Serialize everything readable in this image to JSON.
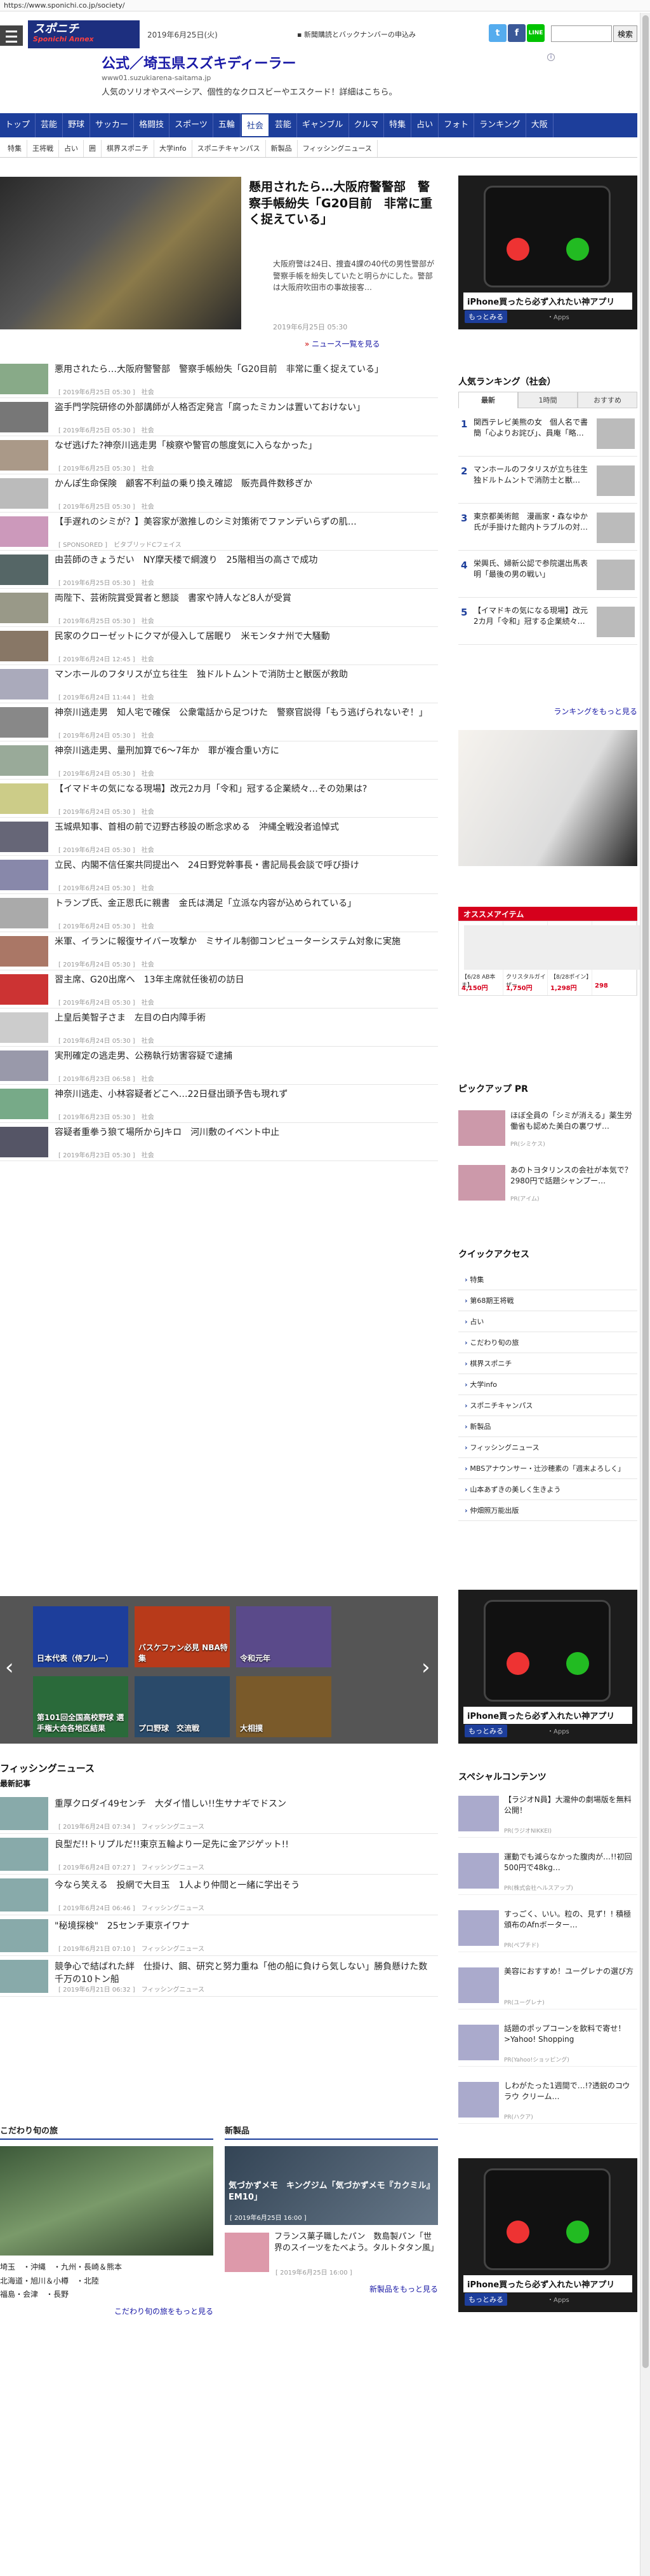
{
  "browser": {
    "url": "https://www.sponichi.co.jp/society/"
  },
  "header": {
    "logo_main": "スポニチ",
    "logo_sub": "Sponichi Annex",
    "date": "2019年6月25日(火)",
    "subscribe": "新聞購読とバックナンバーの申込み",
    "search_button": "検索",
    "search_placeholder": ""
  },
  "header_ad": {
    "title": "公式／埼玉県スズキディーラー",
    "url": "www01.suzukiarena-saitama.jp",
    "desc": "人気のソリオやスペーシア、個性的なクロスビーやエスクード！詳細はこちら。"
  },
  "gnav": [
    "トップ",
    "芸能",
    "野球",
    "サッカー",
    "格闘技",
    "スポーツ",
    "五輪",
    "社会",
    "芸能",
    "ギャンブル",
    "クルマ",
    "特集",
    "占い",
    "フォト",
    "ランキング",
    "大阪"
  ],
  "gnav_active": 7,
  "subnav": [
    "特集",
    "王将戦",
    "占い",
    "囲",
    "棋界スポニチ",
    "大学info",
    "スポニチキャンパス",
    "新製品",
    "フィッシングニュース"
  ],
  "hero": {
    "title": "懸用されたら…大阪府警警部　警察手帳紛失「G20目前　非常に重く捉えている」",
    "body": "大阪府警は24日、捜査4課の40代の男性警部が警察手帳を紛失していたと明らかにした。警部は大阪府吹田市の事故接客…",
    "date": "2019年6月25日 05:30",
    "more": "ニュース一覧を見る"
  },
  "news": [
    {
      "title": "悪用されたら…大阪府警警部　警察手帳紛失「G20目前　非常に重く捉えている」",
      "meta": "[ 2019年6月25日 05:30 ]　社会"
    },
    {
      "title": "盗手門学院研修の外部講師が人格否定発言「腐ったミカンは置いておけない」",
      "meta": "[ 2019年6月25日 05:30 ]　社会"
    },
    {
      "title": "なぜ逃げた?神奈川逃走男「検察や警官の態度気に入らなかった」",
      "meta": "[ 2019年6月25日 05:30 ]　社会"
    },
    {
      "title": "かんぽ生命保険　顧客不利益の乗り換え確認　販売員件数移ぎか",
      "meta": "[ 2019年6月25日 05:30 ]　社会"
    },
    {
      "title": "【手遅れのシミが？】美容家が激推しのシミ対策術でファンデいらずの肌…",
      "meta": "[ SPONSORED ]　ビタブリッドCフェイス"
    },
    {
      "title": "由芸師のきょうだい　NY摩天楼で綱渡り　25階相当の高さで成功",
      "meta": "[ 2019年6月25日 05:30 ]　社会"
    },
    {
      "title": "両陛下、芸術院賞受賞者と懇談　書家や詩人など8人が受賞",
      "meta": "[ 2019年6月25日 05:30 ]　社会"
    },
    {
      "title": "民家のクローゼットにクマが侵入して居眠り　米モンタナ州で大騒動",
      "meta": "[ 2019年6月24日 12:45 ]　社会"
    },
    {
      "title": "マンホールのフタリスが立ち往生　独ドルトムントで消防士と獣医が救助",
      "meta": "[ 2019年6月24日 11:44 ]　社会"
    },
    {
      "title": "神奈川逃走男　知人宅で確保　公衆電話から足つけた　警察官説得「もう逃げられないぞ！」",
      "meta": "[ 2019年6月24日 05:30 ]　社会"
    },
    {
      "title": "神奈川逃走男、量刑加算で6～7年か　罪が複合重い方に",
      "meta": "[ 2019年6月24日 05:30 ]　社会"
    },
    {
      "title": "【イマドキの気になる現場】改元2カ月「令和」冠する企業続々…その効果は?",
      "meta": "[ 2019年6月24日 05:30 ]　社会"
    },
    {
      "title": "玉城県知事、首相の前で辺野古移設の断念求める　沖縄全戦没者追悼式",
      "meta": "[ 2019年6月24日 05:30 ]　社会"
    },
    {
      "title": "立民、内閣不信任案共同提出へ　24日野党幹事長・書記局長会談で呼び掛け",
      "meta": "[ 2019年6月24日 05:30 ]　社会"
    },
    {
      "title": "トランプ氏、金正恩氏に親書　金氏は満足「立派な内容が込められている」",
      "meta": "[ 2019年6月24日 05:30 ]　社会"
    },
    {
      "title": "米軍、イランに報復サイバー攻撃か　ミサイル制御コンピューターシステム対象に実施",
      "meta": "[ 2019年6月24日 05:30 ]　社会"
    },
    {
      "title": "習主席、G20出席へ　13年主席就任後初の訪日",
      "meta": "[ 2019年6月24日 05:30 ]　社会"
    },
    {
      "title": "上皇后美智子さま　左目の白内障手術",
      "meta": "[ 2019年6月24日 05:30 ]　社会"
    },
    {
      "title": "実刑確定の逃走男、公務執行妨害容疑で逮捕",
      "meta": "[ 2019年6月23日 06:58 ]　社会"
    },
    {
      "title": "神奈川逃走、小林容疑者どこへ…22日昼出頭予告も現れず",
      "meta": "[ 2019年6月23日 05:30 ]　社会"
    },
    {
      "title": "容疑者重拳う狼て場所からJキロ　河川敷のイベント中止",
      "meta": "[ 2019年6月23日 05:30 ]　社会"
    }
  ],
  "carousel": {
    "tiles": [
      "日本代表（侍ブルー）",
      "バスケファン必見 NBA特集",
      "令和元年",
      "第101回全国高校野球 選手権大会各地区結果",
      "プロ野球　交流戦",
      "大相撲"
    ]
  },
  "fishing": {
    "heading": "フィッシングニュース",
    "subheading": "最新記事",
    "items": [
      {
        "title": "重厚クロダイ49センチ　大ダイ惜しい!!生サナギでドスン",
        "meta": "[ 2019年6月24日 07:34 ]　フィッシングニュース"
      },
      {
        "title": "良型だ!!トリプルだ!!東京五輪より一足先に金アジゲット!!",
        "meta": "[ 2019年6月24日 07:27 ]　フィッシングニュース"
      },
      {
        "title": "今なら笑える　投網で大目玉　1人より仲間と一緒に学出そう",
        "meta": "[ 2019年6月24日 06:46 ]　フィッシングニュース"
      },
      {
        "title": "\"秘境探検\"　25センチ東京イワナ",
        "meta": "[ 2019年6月21日 07:10 ]　フィッシングニュース"
      },
      {
        "title": "競争心で結ばれた絆　仕掛け、餌、研究と努力重ね「他の船に負けら気しない」勝負懸けた数千万の10トン船",
        "meta": "[ 2019年6月21日 06:32 ]　フィッシングニュース"
      }
    ]
  },
  "kodawari": {
    "heading": "こだわり旬の旅",
    "links": [
      "埼玉　・沖縄　・九州・長崎＆熊本",
      "北海道・旭川＆小樽　・北陸",
      "福島・会津　・長野"
    ],
    "more": "こだわり旬の旅をもっと見る"
  },
  "shinseihin": {
    "heading": "新製品",
    "item1_title": "気づかずメモ　キングジム「気づかずメモ『カクミル』EM10」",
    "item1_date": "[ 2019年6月25日 16:00 ]",
    "item2_title": "フランス菓子職したパン　数島製パン「世界のスイーツをたべよう。タルトタタン風」",
    "item2_date": "[ 2019年6月25日 16:00 ]",
    "more": "新製品をもっと見る"
  },
  "side_ads": {
    "caption": "iPhone買ったら必ず入れたい神アプリ",
    "more": "もっとみる",
    "apps": "・Apps"
  },
  "ranking": {
    "heading": "人気ランキング（社会）",
    "tabs": [
      "最新",
      "1時間",
      "おすすめ"
    ],
    "items": [
      {
        "n": "1",
        "title": "関西テレビ美熊の女　個人名で書簡「心よりお詫び」、員庵「略…"
      },
      {
        "n": "2",
        "title": "マンホールのフタリスが立ち往生　独ドルトムントで消防士と獣…"
      },
      {
        "n": "3",
        "title": "東京都美術館　漫画家・森なゆか氏が手掛けた館内トラブルの対…"
      },
      {
        "n": "4",
        "title": "栄興氏、婦新公認で参院選出馬表明「最後の男の戦い」"
      },
      {
        "n": "5",
        "title": "【イマドキの気になる現場】改元2カ月「令和」冠する企業続々…"
      }
    ],
    "more": "ランキングをもっと見る"
  },
  "osusume": {
    "heading": "オススメアイテム",
    "items": [
      {
        "name": "【6/28 AB本ま】",
        "price": "4,150円"
      },
      {
        "name": "クリスタルガイザー",
        "price": "1,750円"
      },
      {
        "name": "【8/28ポイン】",
        "price": "1,298円"
      },
      {
        "name": "",
        "price": "298"
      }
    ]
  },
  "pickup_pr": {
    "heading": "ピックアップ PR",
    "items": [
      {
        "title": "ほぼ全員の「シミが消える」薬生労働省も認めた美白の裏ワザ…",
        "src": "PR(シミケス)"
      },
      {
        "title": "あのトヨタリンスの会社が本気で？2980円で話題シャンプー…",
        "src": "PR(アイム)"
      }
    ]
  },
  "quick_access": {
    "heading": "クイックアクセス",
    "items": [
      "特集",
      "第68期王将戦",
      "占い",
      "こだわり旬の旅",
      "棋界スポニチ",
      "大学info",
      "スポニチキャンパス",
      "新製品",
      "フィッシングニュース",
      "MBSアナウンサー・辻沙穂素の「週末よろしく」",
      "山本あずきの美しく生きよう",
      "仲畑照万能出版"
    ]
  },
  "special": {
    "heading": "スペシャルコンテンツ",
    "items": [
      {
        "title": "【ラジオN員】大瀧仲の劇場版を無料公開！",
        "src": "PR(ラジオNIKKEI)"
      },
      {
        "title": "運動でも減らなかった腹肉が…!!初回500円で48kg…",
        "src": "PR(株式会社ヘルスアップ)"
      },
      {
        "title": "すっごく、いい。粒の、見ず！! 積極頒布のAfnボーター…",
        "src": "PR(ぺプチド)"
      },
      {
        "title": "美容におすすめ！ユーグレナの選び方",
        "src": "PR(ユーグレナ)"
      },
      {
        "title": "話題のポップコーンを飲料で寄せ！>Yahoo! Shopping",
        "src": "PR(Yahoo!ショッピング)"
      },
      {
        "title": "しわがたった1週間で…!?透鋭のコウラウ クリーム…",
        "src": "PR(ハクア)"
      }
    ]
  }
}
